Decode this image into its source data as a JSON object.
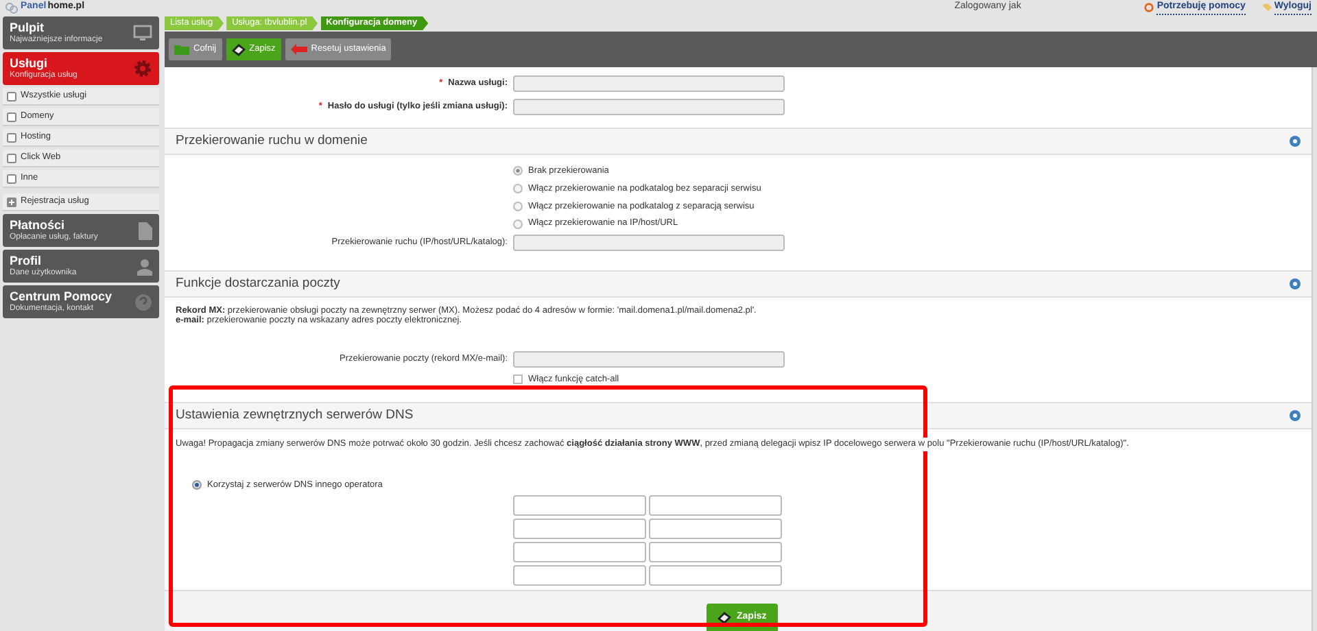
{
  "header": {
    "logo": [
      "Panel",
      "home.pl"
    ],
    "logged_in_label": "Zalogowany jak",
    "links": [
      {
        "label": "Potrzebuję pomocy"
      },
      {
        "label": "Wyloguj"
      }
    ]
  },
  "sidebar": {
    "items": [
      {
        "kind": "card",
        "title": "Pulpit",
        "subtitle": "Najważniejsze informacje",
        "selected": false
      },
      {
        "kind": "card",
        "title": "Usługi",
        "subtitle": "Konfiguracja usług",
        "selected": true
      },
      {
        "kind": "subitem",
        "label": "Wszystkie usługi",
        "selected": false
      },
      {
        "kind": "subitem",
        "label": "Domeny",
        "selected": false
      },
      {
        "kind": "subitem",
        "label": "Hosting",
        "selected": false
      },
      {
        "kind": "subitem",
        "label": "Click Web",
        "selected": false
      },
      {
        "kind": "subitem",
        "label": "Inne",
        "selected": false
      },
      {
        "kind": "action",
        "label": "Rejestracja usług",
        "selected": false
      },
      {
        "kind": "card",
        "title": "Płatności",
        "subtitle": "Opłacanie usług, faktury",
        "selected": false
      },
      {
        "kind": "card",
        "title": "Profil",
        "subtitle": "Dane użytkownika",
        "selected": false
      },
      {
        "kind": "card",
        "title": "Centrum Pomocy",
        "subtitle": "Dokumentacja, kontakt",
        "selected": false
      }
    ]
  },
  "breadcrumb": [
    {
      "label": "Lista usług",
      "selected": false
    },
    {
      "label": "Usługa: tbvlublin.pl",
      "selected": false
    },
    {
      "label": "Konfiguracja domeny",
      "selected": true
    }
  ],
  "toolbar": [
    {
      "kind": "back",
      "label": "Cofnij"
    },
    {
      "kind": "save",
      "label": "Zapisz"
    },
    {
      "kind": "reset",
      "label": "Resetuj ustawienia"
    }
  ],
  "service_fields": [
    {
      "marker": "*",
      "label": "Nazwa usługi:",
      "disabled": true
    },
    {
      "marker": "*",
      "label": "Hasło do usługi (tylko jeśli zmiana usługi):",
      "disabled": true
    }
  ],
  "redirect_section": {
    "title": "Przekierowanie ruchu w domenie",
    "options": [
      {
        "label": "Brak przekierowania",
        "selected": true
      },
      {
        "label": "Włącz przekierowanie na podkatalog bez separacji serwisu",
        "selected": false
      },
      {
        "label": "Włącz przekierowanie na podkatalog z separacją serwisu",
        "selected": false
      },
      {
        "label": "Włącz przekierowanie na IP/host/URL",
        "selected": false
      }
    ],
    "field": {
      "label": "Przekierowanie ruchu (IP/host/URL/katalog):",
      "disabled": true
    }
  },
  "mail_section": {
    "title": "Funkcje dostarczania poczty",
    "description": [
      "**Rekord MX:** przekierowanie obsługi poczty na zewnętrzny serwer (MX). Możesz podać do 4 adresów w formie: 'mail.domena1.pl/mail.domena2.pl'.",
      "**e-mail:** przekierowanie poczty na wskazany adres poczty elektronicznej."
    ],
    "field": {
      "label": "Przekierowanie poczty (rekord MX/e-mail):",
      "disabled": true
    },
    "catch_all": {
      "label": "Włącz funkcję catch-all",
      "checked": false
    }
  },
  "dns_section": {
    "title": "Ustawienia zewnętrznych serwerów DNS",
    "notice": "Uwaga! Propagacja zmiany serwerów DNS może potrwać około 30 godzin. Jeśli chcesz zachować **ciągłość działania strony WWW**, przed zmianą delegacji wpisz IP docelowego serwera w polu \"Przekierowanie ruchu (IP/host/URL/katalog)\".",
    "option": {
      "label": "Korzystaj z serwerów DNS innego operatora",
      "selected": true
    }
  },
  "submit": {
    "label": "Zapisz"
  }
}
